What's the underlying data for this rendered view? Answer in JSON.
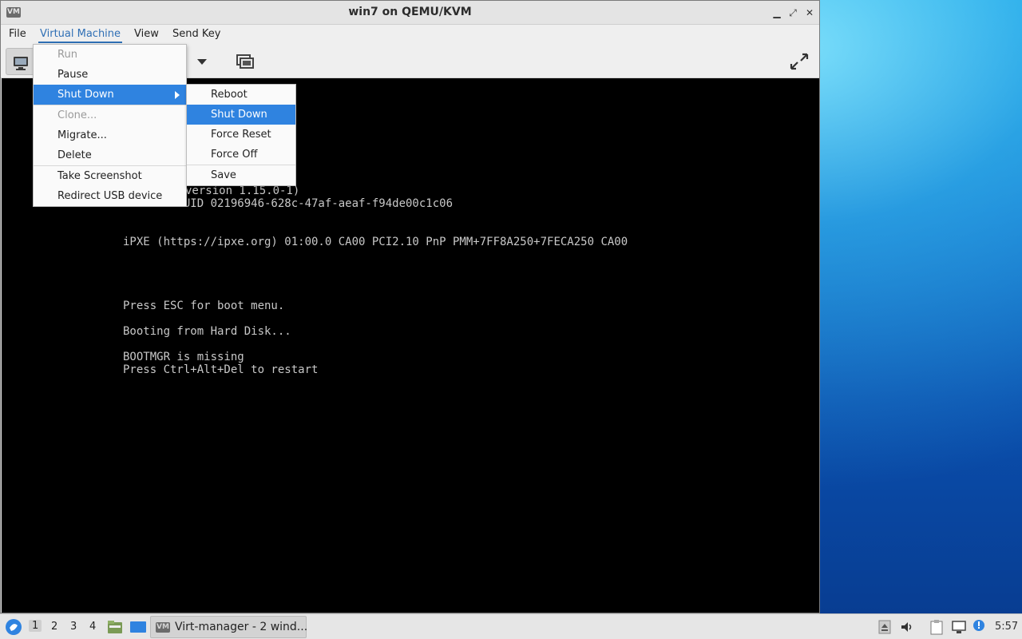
{
  "window": {
    "title": "win7 on QEMU/KVM",
    "app_icon": "virt-manager-icon"
  },
  "menubar": {
    "items": [
      "File",
      "Virtual Machine",
      "View",
      "Send Key"
    ],
    "active": "Virtual Machine"
  },
  "vm_menu": {
    "items": [
      {
        "label": "Run",
        "state": "disabled"
      },
      {
        "label": "Pause",
        "state": "normal"
      },
      {
        "label": "Shut Down",
        "state": "highlighted"
      },
      {
        "label": "Clone...",
        "state": "disabled"
      },
      {
        "label": "Migrate...",
        "state": "normal"
      },
      {
        "label": "Delete",
        "state": "normal"
      },
      {
        "label": "Take Screenshot",
        "state": "normal"
      },
      {
        "label": "Redirect USB device",
        "state": "normal"
      }
    ]
  },
  "shutdown_submenu": {
    "items": [
      {
        "label": "Reboot",
        "state": "normal"
      },
      {
        "label": "Shut Down",
        "state": "highlighted"
      },
      {
        "label": "Force Reset",
        "state": "normal"
      },
      {
        "label": "Force Off",
        "state": "normal"
      },
      {
        "label": "Save",
        "state": "normal"
      }
    ]
  },
  "console": {
    "lines": [
      "version 1.15.0-1)",
      "Machine UUID 02196946-628c-47af-aeaf-f94de00c1c06",
      "iPXE (https://ipxe.org) 01:00.0 CA00 PCI2.10 PnP PMM+7FF8A250+7FECA250 CA00",
      "Press ESC for boot menu.",
      "Booting from Hard Disk...",
      "BOOTMGR is missing",
      "Press Ctrl+Alt+Del to restart"
    ]
  },
  "taskbar": {
    "workspaces": [
      "1",
      "2",
      "3",
      "4"
    ],
    "active_workspace": "1",
    "task_label": "Virt-manager - 2 wind...",
    "clock": "5:57"
  },
  "colors": {
    "highlight": "#2f83e0",
    "accent": "#2f6fb5",
    "console_bg": "#000000"
  }
}
